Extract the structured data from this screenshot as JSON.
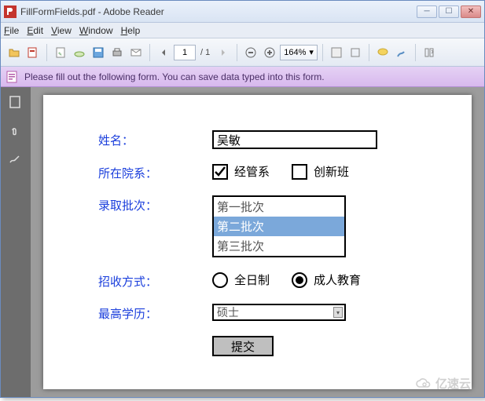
{
  "window": {
    "title": "FillFormFields.pdf - Adobe Reader",
    "menu": {
      "file": "File",
      "edit": "Edit",
      "view": "View",
      "window": "Window",
      "help": "Help"
    }
  },
  "toolbar": {
    "page_current": "1",
    "page_total": "/ 1",
    "zoom": "164%"
  },
  "infobar": {
    "message": "Please fill out the following form. You can save data typed into this form."
  },
  "form": {
    "name_label": "姓名：",
    "name_value": "吴敏",
    "department_label": "所在院系：",
    "dept_opt1": "经管系",
    "dept_opt2": "创新班",
    "dept_opt1_checked": true,
    "dept_opt2_checked": false,
    "batch_label": "录取批次：",
    "batch_options": [
      "第一批次",
      "第二批次",
      "第三批次"
    ],
    "batch_selected_index": 1,
    "mode_label": "招收方式：",
    "mode_opt1": "全日制",
    "mode_opt2": "成人教育",
    "mode_selected": "成人教育",
    "edu_label": "最高学历：",
    "edu_value": "硕士",
    "submit_label": "提交"
  },
  "watermark": "亿速云"
}
